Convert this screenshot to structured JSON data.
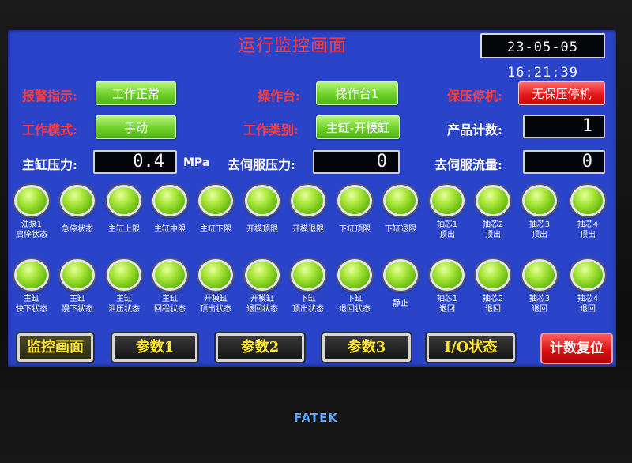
{
  "header": {
    "title": "运行监控画面",
    "clock": "23-05-05 16:21:39"
  },
  "status": {
    "alarm_label": "报警指示:",
    "alarm_value": "工作正常",
    "console_label": "操作台:",
    "console_value": "操作台1",
    "hold_stop_label": "保压停机:",
    "hold_stop_value": "无保压停机",
    "mode_label": "工作模式:",
    "mode_value": "手动",
    "type_label": "工作类别:",
    "type_value": "主缸-开模缸",
    "count_label": "产品计数:",
    "count_value": "1",
    "main_pressure_label": "主缸压力:",
    "main_pressure_value": "0.4",
    "main_pressure_unit": "MPa",
    "servo_pressure_label": "去伺服压力:",
    "servo_pressure_value": "0",
    "servo_flow_label": "去伺服流量:",
    "servo_flow_value": "0"
  },
  "lamps_row1": [
    {
      "line1": "油泵1",
      "line2": "启停状态"
    },
    {
      "line1": "急停状态",
      "line2": ""
    },
    {
      "line1": "主缸上限",
      "line2": ""
    },
    {
      "line1": "主缸中限",
      "line2": ""
    },
    {
      "line1": "主缸下限",
      "line2": ""
    },
    {
      "line1": "开模顶限",
      "line2": ""
    },
    {
      "line1": "开模退限",
      "line2": ""
    },
    {
      "line1": "下缸顶限",
      "line2": ""
    },
    {
      "line1": "下缸退限",
      "line2": ""
    },
    {
      "line1": "抽芯1",
      "line2": "顶出"
    },
    {
      "line1": "抽芯2",
      "line2": "顶出"
    },
    {
      "line1": "抽芯3",
      "line2": "顶出"
    },
    {
      "line1": "抽芯4",
      "line2": "顶出"
    }
  ],
  "lamps_row2": [
    {
      "line1": "主缸",
      "line2": "快下状态"
    },
    {
      "line1": "主缸",
      "line2": "慢下状态"
    },
    {
      "line1": "主缸",
      "line2": "泄压状态"
    },
    {
      "line1": "主缸",
      "line2": "回程状态"
    },
    {
      "line1": "开模缸",
      "line2": "顶出状态"
    },
    {
      "line1": "开模缸",
      "line2": "退回状态"
    },
    {
      "line1": "下缸",
      "line2": "顶出状态"
    },
    {
      "line1": "下缸",
      "line2": "退回状态"
    },
    {
      "line1": "静止",
      "line2": ""
    },
    {
      "line1": "抽芯1",
      "line2": "退回"
    },
    {
      "line1": "抽芯2",
      "line2": "退回"
    },
    {
      "line1": "抽芯3",
      "line2": "退回"
    },
    {
      "line1": "抽芯4",
      "line2": "退回"
    }
  ],
  "nav": {
    "monitor": "监控画面",
    "param1": "参数1",
    "param2": "参数2",
    "param3": "参数3",
    "io": "I/O状态",
    "reset": "计数复位"
  },
  "brand": "FATEK"
}
